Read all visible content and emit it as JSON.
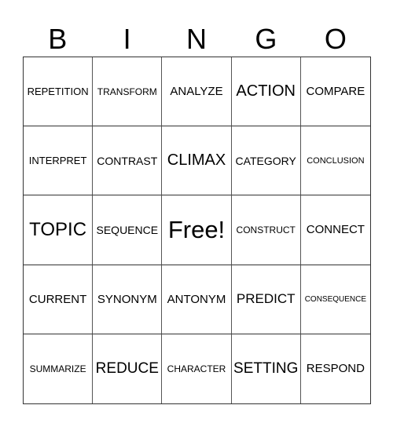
{
  "header": [
    "B",
    "I",
    "N",
    "G",
    "O"
  ],
  "cells": [
    "REPETITION",
    "TRANSFORM",
    "ANALYZE",
    "ACTION",
    "COMPARE",
    "INTERPRET",
    "CONTRAST",
    "CLIMAX",
    "CATEGORY",
    "CONCLUSION",
    "TOPIC",
    "SEQUENCE",
    "Free!",
    "CONSTRUCT",
    "CONNECT",
    "CURRENT",
    "SYNONYM",
    "ANTONYM",
    "PREDICT",
    "CONSEQUENCE",
    "SUMMARIZE",
    "REDUCE",
    "CHARACTER",
    "SETTING",
    "RESPOND"
  ]
}
